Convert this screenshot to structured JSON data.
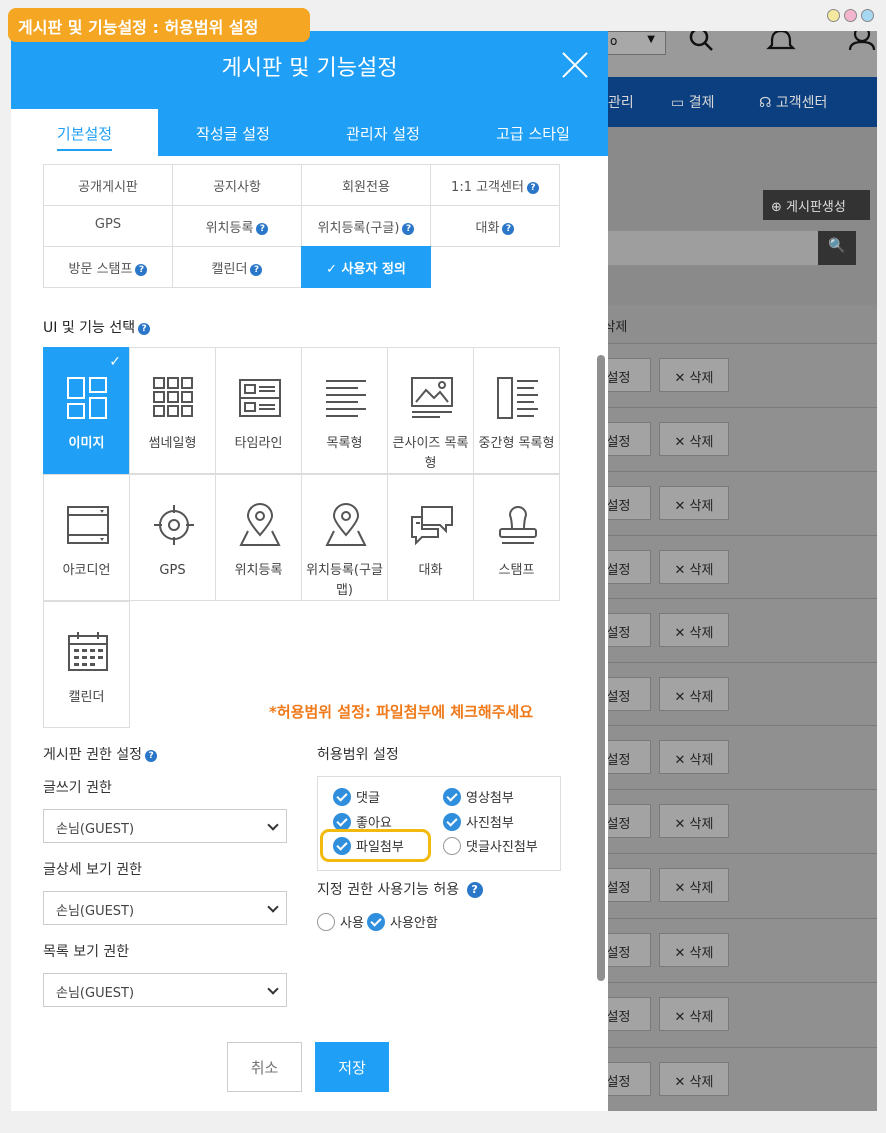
{
  "badge": "게시판 및 기능설정 : 허용범위 설정",
  "background": {
    "select_value": "o",
    "nav": [
      "관리",
      "결제",
      "고객센터"
    ],
    "create_button": "게시판생성",
    "col_header": "/삭제",
    "row_buttons": {
      "setting": "설정",
      "delete": "삭제"
    }
  },
  "modal": {
    "title": "게시판 및 기능설정",
    "tabs": [
      "기본설정",
      "작성글 설정",
      "관리자 설정",
      "고급 스타일"
    ],
    "features": [
      "공개게시판",
      "공지사항",
      "회원전용",
      "1:1 고객센터",
      "GPS",
      "위치등록",
      "위치등록(구글)",
      "대화",
      "방문 스탬프",
      "캘린더",
      "사용자 정의"
    ],
    "ui_section_title": "UI 및 기능 선택",
    "ui_items": [
      "이미지",
      "썸네일형",
      "타임라인",
      "목록형",
      "큰사이즈 목록형",
      "중간형 목록형",
      "아코디언",
      "GPS",
      "위치등록",
      "위치등록(구글맵)",
      "대화",
      "스탬프",
      "캘린더"
    ],
    "notice": "*허용범위 설정: 파일첨부에 체크해주세요",
    "perm_title": "게시판 권한 설정",
    "write_label": "글쓰기 권한",
    "detail_label": "글상세 보기 권한",
    "list_label": "목록 보기 권한",
    "guest": "손님(GUEST)",
    "scope_title": "허용범위 설정",
    "scope": {
      "comment": "댓글",
      "video": "영상첨부",
      "like": "좋아요",
      "photo": "사진첨부",
      "file": "파일첨부",
      "comment_photo": "댓글사진첨부"
    },
    "assign_title": "지정 권한 사용기능 허용",
    "use": "사용",
    "not_use": "사용안함",
    "cancel": "취소",
    "save": "저장"
  }
}
